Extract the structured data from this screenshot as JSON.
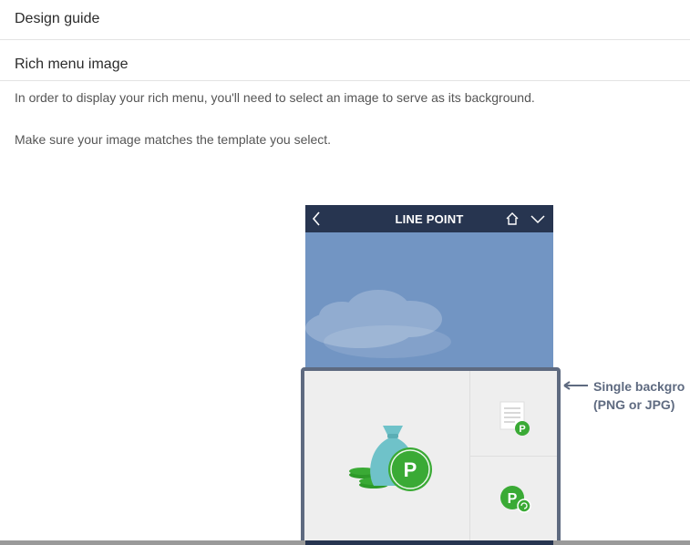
{
  "sections": {
    "design_guide_title": "Design guide",
    "rich_menu_title": "Rich menu image",
    "paragraph_1": "In order to display your rich menu, you'll need to select an image to serve as its background.",
    "paragraph_2": "Make sure your image matches the template you select."
  },
  "illustration": {
    "phone_title": "LINE POINT",
    "annotation_line1": "Single backgro",
    "annotation_line2": "(PNG or JPG)",
    "point_letter": "P",
    "icons": [
      "back-icon",
      "home-icon",
      "chevron-down-icon",
      "money-bag-icon",
      "document-point-icon",
      "point-exchange-icon",
      "arrow-left-icon"
    ],
    "colors": {
      "header": "#273550",
      "sky": "#7295c3",
      "frame": "#5e6a80",
      "point_green": "#3aaa35",
      "bag_teal": "#6fc2c9"
    }
  }
}
